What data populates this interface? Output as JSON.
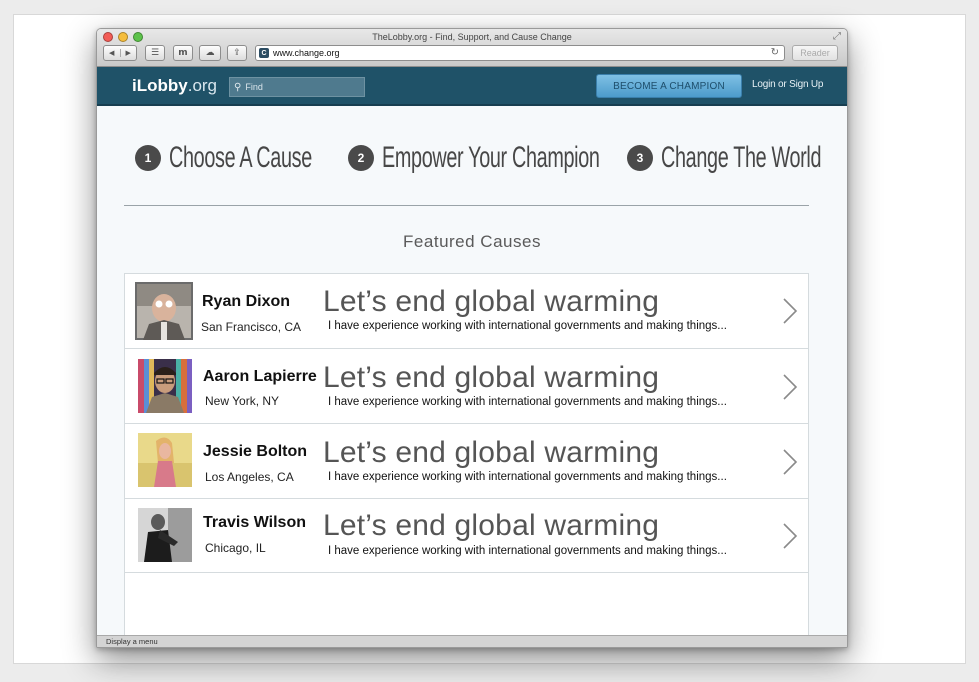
{
  "window": {
    "title": "TheLobby.org - Find, Support, and Cause Change",
    "url": "www.change.org",
    "favicon_letter": "C",
    "reader_label": "Reader",
    "status_text": "Display a menu"
  },
  "header": {
    "logo_bold": "iLobby",
    "logo_suffix": ".org",
    "search_placeholder": "Find",
    "champion_button": "BECOME A CHAMPION",
    "login_link": "Login or Sign Up",
    "bg_color": "#1f5268"
  },
  "steps": [
    {
      "num": "1",
      "label": "Choose A Cause"
    },
    {
      "num": "2",
      "label": "Empower Your Champion"
    },
    {
      "num": "3",
      "label": "Change The World"
    }
  ],
  "featured_heading": "Featured Causes",
  "causes": [
    {
      "name": "Ryan Dixon",
      "location": "San Francisco, CA",
      "title": "Let’s end global warming",
      "description": "I have experience working with international governments and making things..."
    },
    {
      "name": "Aaron Lapierre",
      "location": "New York, NY",
      "title": "Let’s end global warming",
      "description": "I have experience working with international governments and making things..."
    },
    {
      "name": "Jessie Bolton",
      "location": "Los Angeles, CA",
      "title": "Let’s end global warming",
      "description": "I have experience working with international governments and making things..."
    },
    {
      "name": "Travis Wilson",
      "location": "Chicago, IL",
      "title": "Let’s end global warming",
      "description": "I have experience working with international governments and making things..."
    }
  ]
}
